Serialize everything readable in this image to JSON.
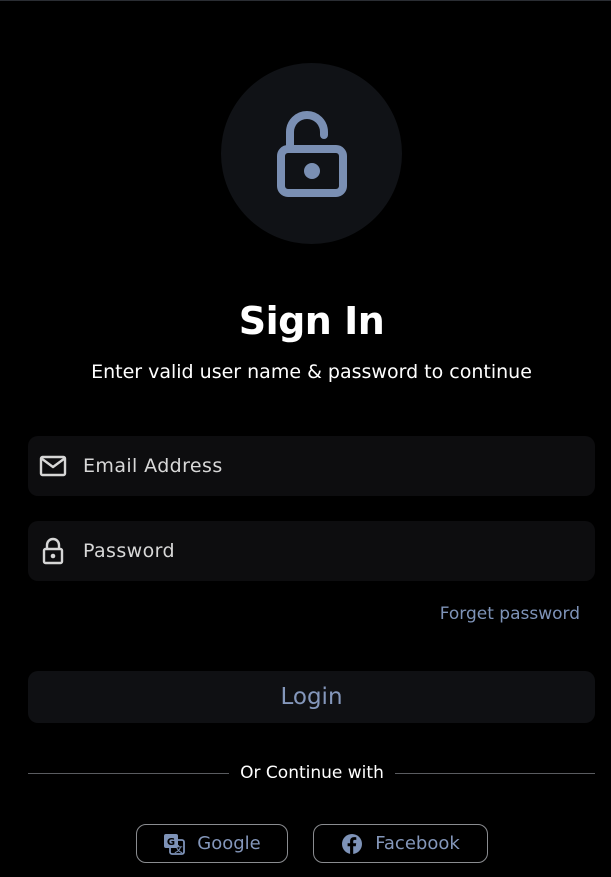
{
  "header": {
    "icon": "lock-open-icon",
    "title": "Sign In",
    "subtitle": "Enter valid user name & password to continue"
  },
  "form": {
    "email": {
      "icon": "mail-icon",
      "placeholder": "Email Address",
      "value": ""
    },
    "password": {
      "icon": "lock-icon",
      "placeholder": "Password",
      "value": ""
    },
    "forget_label": "Forget password",
    "login_label": "Login"
  },
  "social": {
    "divider_label": "Or Continue with",
    "google": {
      "icon": "google-translate-icon",
      "label": "Google"
    },
    "facebook": {
      "icon": "facebook-icon",
      "label": "Facebook"
    }
  },
  "colors": {
    "background": "#000000",
    "accent": "#7e93b8",
    "field_bg": "#0d0d0f",
    "circle_bg": "#101216"
  }
}
